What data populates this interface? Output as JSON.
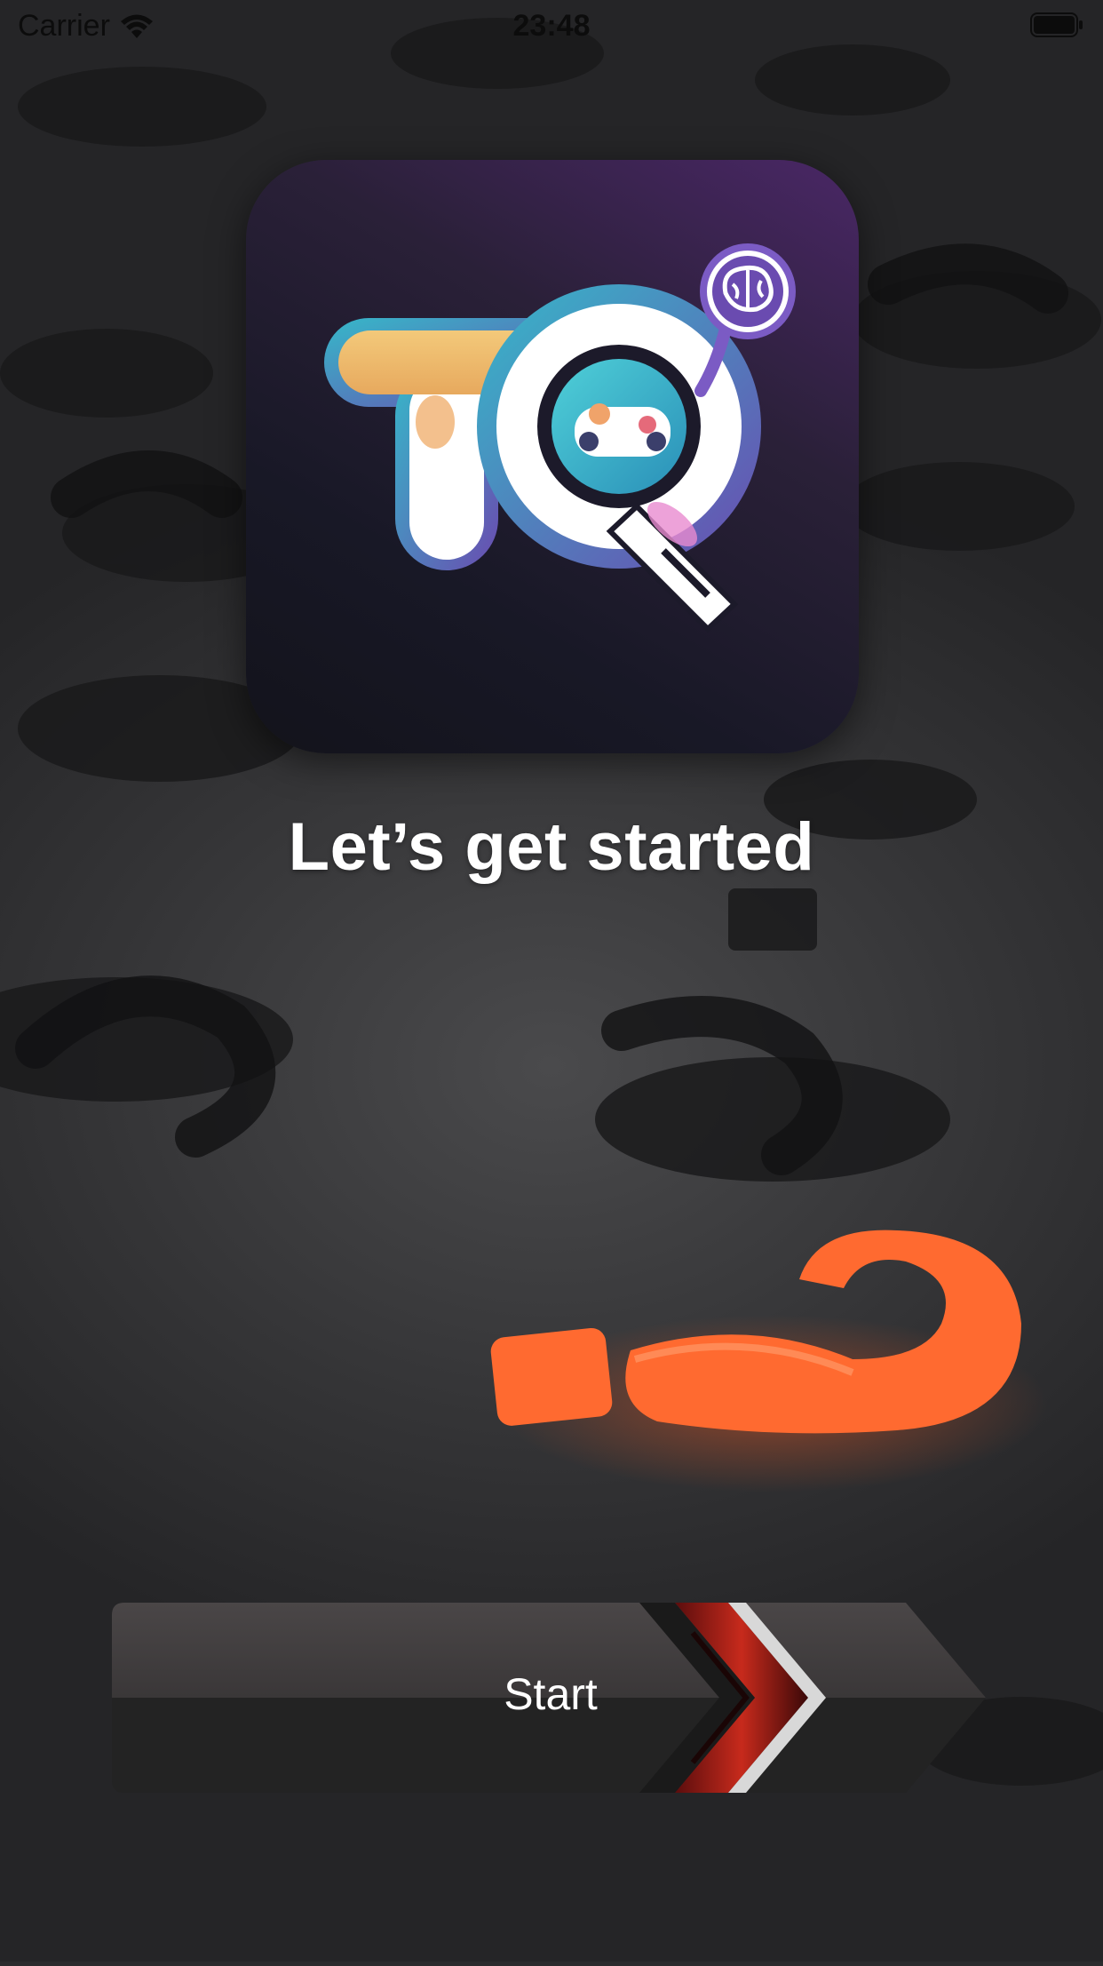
{
  "status_bar": {
    "carrier": "Carrier",
    "time": "23:48",
    "wifi_icon": "wifi-icon",
    "battery_icon": "battery-icon"
  },
  "logo": {
    "letters": "TQ",
    "icons": [
      "gamepad-icon",
      "brain-icon"
    ]
  },
  "main": {
    "title": "Let’s get started"
  },
  "start_button": {
    "label": "Start",
    "icon": "chevron-right-icon"
  },
  "colors": {
    "accent_orange": "#ff5a1f",
    "title_text": "#ffffff",
    "background": "#2b2b2d",
    "logo_bg": "#181826"
  }
}
